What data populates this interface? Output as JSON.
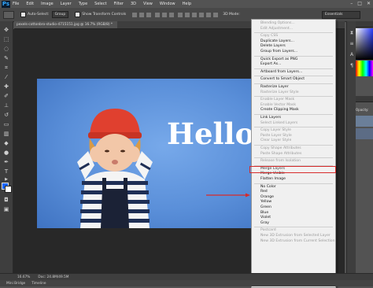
{
  "app": {
    "logo": "Ps"
  },
  "menubar": {
    "items": [
      "File",
      "Edit",
      "Image",
      "Layer",
      "Type",
      "Select",
      "Filter",
      "3D",
      "View",
      "Window",
      "Help"
    ],
    "window_controls": [
      "–",
      "□",
      "✕"
    ]
  },
  "options_bar": {
    "auto_select_label": "Auto-Select:",
    "auto_select_value": "Group",
    "show_transform_label": "Show Transform Controls",
    "mode_3d_label": "3D Mode:",
    "workspace": "Essentials"
  },
  "document": {
    "tab_title": "pexels-cottonbro-studio-4715151.jpg @ 16.7% (RGB/8) *",
    "photo_text": "Hello"
  },
  "context_menu": {
    "items": [
      {
        "label": "Blending Options...",
        "enabled": false
      },
      {
        "label": "Edit Adjustment...",
        "enabled": false
      },
      {
        "sep": true
      },
      {
        "label": "Copy CSS",
        "enabled": false
      },
      {
        "label": "Duplicate Layers...",
        "enabled": true
      },
      {
        "label": "Delete Layers",
        "enabled": true
      },
      {
        "label": "Group from Layers...",
        "enabled": true
      },
      {
        "sep": true
      },
      {
        "label": "Quick Export as PNG",
        "enabled": true
      },
      {
        "label": "Export As...",
        "enabled": true
      },
      {
        "sep": true
      },
      {
        "label": "Artboard from Layers...",
        "enabled": true
      },
      {
        "sep": true
      },
      {
        "label": "Convert to Smart Object",
        "enabled": true
      },
      {
        "sep": true
      },
      {
        "label": "Rasterize Layer",
        "enabled": true
      },
      {
        "label": "Rasterize Layer Style",
        "enabled": false
      },
      {
        "sep": true
      },
      {
        "label": "Enable Layer Mask",
        "enabled": false
      },
      {
        "label": "Enable Vector Mask",
        "enabled": false
      },
      {
        "label": "Create Clipping Mask",
        "enabled": true
      },
      {
        "sep": true
      },
      {
        "label": "Link Layers",
        "enabled": true
      },
      {
        "label": "Select Linked Layers",
        "enabled": false
      },
      {
        "sep": true
      },
      {
        "label": "Copy Layer Style",
        "enabled": false
      },
      {
        "label": "Paste Layer Style",
        "enabled": false
      },
      {
        "label": "Clear Layer Style",
        "enabled": false
      },
      {
        "sep": true
      },
      {
        "label": "Copy Shape Attributes",
        "enabled": false
      },
      {
        "label": "Paste Shape Attributes",
        "enabled": false
      },
      {
        "sep": true
      },
      {
        "label": "Release from Isolation",
        "enabled": false
      },
      {
        "sep": true
      },
      {
        "label": "Merge Layers",
        "enabled": true,
        "highlighted": true
      },
      {
        "label": "Merge Visible",
        "enabled": true
      },
      {
        "label": "Flatten Image",
        "enabled": true
      },
      {
        "sep": true
      },
      {
        "label": "No Color",
        "enabled": true
      },
      {
        "label": "Red",
        "enabled": true
      },
      {
        "label": "Orange",
        "enabled": true
      },
      {
        "label": "Yellow",
        "enabled": true
      },
      {
        "label": "Green",
        "enabled": true
      },
      {
        "label": "Blue",
        "enabled": true
      },
      {
        "label": "Violet",
        "enabled": true
      },
      {
        "label": "Gray",
        "enabled": true
      },
      {
        "sep": true
      },
      {
        "label": "Postcard",
        "enabled": false
      },
      {
        "label": "New 3D Extrusion from Selected Layer",
        "enabled": false
      },
      {
        "label": "New 3D Extrusion from Current Selection",
        "enabled": false
      }
    ]
  },
  "right_panel": {
    "opacity_label": "Opacity:"
  },
  "status_bar": {
    "zoom": "16.67%",
    "doc_info": "Doc: 24.8M/49.5M"
  },
  "bottom_bar": {
    "mini_bridge": "Mini Bridge",
    "timeline": "Timeline"
  },
  "colors": {
    "highlight_border": "#d72b2b",
    "photo_bg": "#5a8fd9",
    "menu_bg": "#f0f0f0",
    "ui_dark": "#535353"
  }
}
